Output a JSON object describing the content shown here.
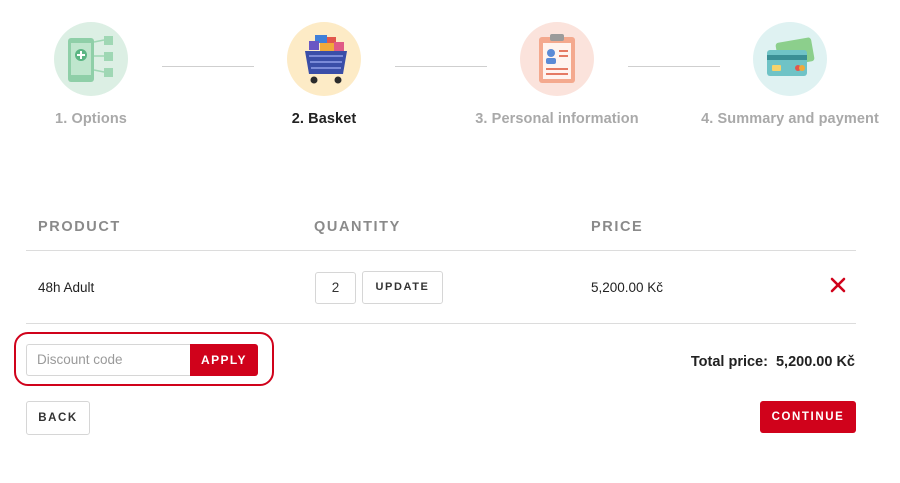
{
  "steps": [
    {
      "label": "1. Options",
      "icon": "phone-options-icon",
      "bg": "#dcefe4",
      "active": false
    },
    {
      "label": "2. Basket",
      "icon": "basket-cart-icon",
      "bg": "#fdebc6",
      "active": true
    },
    {
      "label": "3. Personal information",
      "icon": "clipboard-profile-icon",
      "bg": "#fbe3dc",
      "active": false
    },
    {
      "label": "4. Summary and payment",
      "icon": "credit-cards-icon",
      "bg": "#dff2f2",
      "active": false
    }
  ],
  "table": {
    "headers": {
      "product": "PRODUCT",
      "quantity": "QUANTITY",
      "price": "PRICE"
    },
    "rows": [
      {
        "product": "48h Adult",
        "quantity": "2",
        "update_label": "UPDATE",
        "price": "5,200.00 Kč"
      }
    ]
  },
  "discount": {
    "placeholder": "Discount code",
    "apply_label": "APPLY"
  },
  "total": {
    "label": "Total price:",
    "amount": "5,200.00 Kč"
  },
  "actions": {
    "back_label": "BACK",
    "continue_label": "CONTINUE"
  },
  "colors": {
    "accent": "#d0021b",
    "muted_text": "#a9a9a9"
  }
}
